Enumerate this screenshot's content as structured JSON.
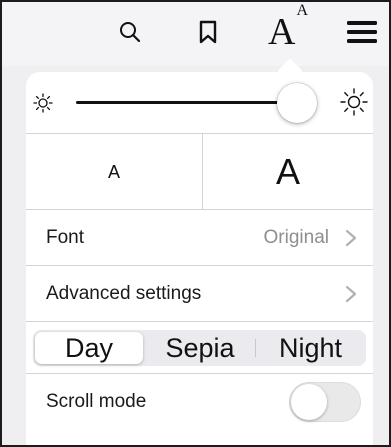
{
  "toolbar": {
    "font_button": {
      "big": "A",
      "small": "A"
    },
    "icons": [
      "search-icon",
      "bookmark-icon",
      "font-settings-icon",
      "menu-icon"
    ]
  },
  "brightness": {
    "level": 0.92,
    "icons": [
      "brightness-low-icon",
      "brightness-high-icon"
    ]
  },
  "font_size": {
    "smaller_label": "A",
    "larger_label": "A"
  },
  "font": {
    "label": "Font",
    "value": "Original"
  },
  "advanced": {
    "label": "Advanced settings"
  },
  "theme": {
    "options": [
      "Day",
      "Sepia",
      "Night"
    ],
    "selected": "Day"
  },
  "scroll_mode": {
    "label": "Scroll mode",
    "enabled": false
  },
  "colors": {
    "background": "#efeff2",
    "panel": "#ffffff",
    "separator": "#d4d4d8",
    "secondary_text": "#8e8e93",
    "toggle_off": "#e9e9ea"
  }
}
